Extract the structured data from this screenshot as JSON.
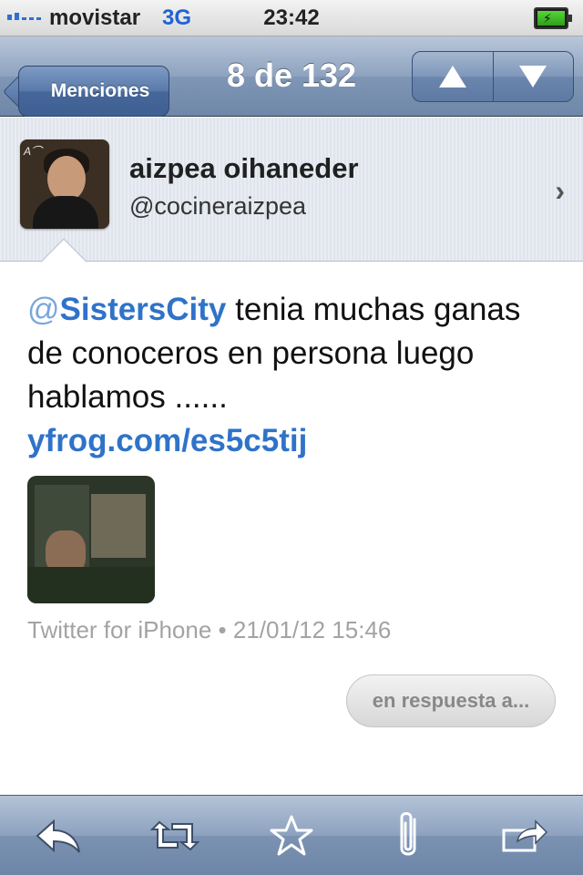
{
  "status": {
    "carrier": "movistar",
    "network": "3G",
    "time": "23:42",
    "battery_icon": "battery-charging-icon"
  },
  "nav": {
    "back_label": "Menciones",
    "title": "8 de 132",
    "prev_icon": "up-arrow-icon",
    "next_icon": "down-arrow-icon"
  },
  "user": {
    "display_name": "aizpea oihaneder",
    "handle": "@cocineraizpea"
  },
  "tweet": {
    "at_symbol": "@",
    "mention": "SistersCity",
    "text": " tenia muchas ganas de conoceros en persona luego hablamos ......",
    "link": "yfrog.com/es5c5tij",
    "meta": "Twitter for iPhone • 21/01/12 15:46",
    "reply_label": "en respuesta a..."
  },
  "toolbar": {
    "items": [
      "reply-icon",
      "retweet-icon",
      "star-icon",
      "paperclip-icon",
      "share-icon"
    ]
  },
  "colors": {
    "link": "#2f73c9",
    "nav_bar": "#8ea3bf",
    "meta_text": "#a3a3a3"
  }
}
